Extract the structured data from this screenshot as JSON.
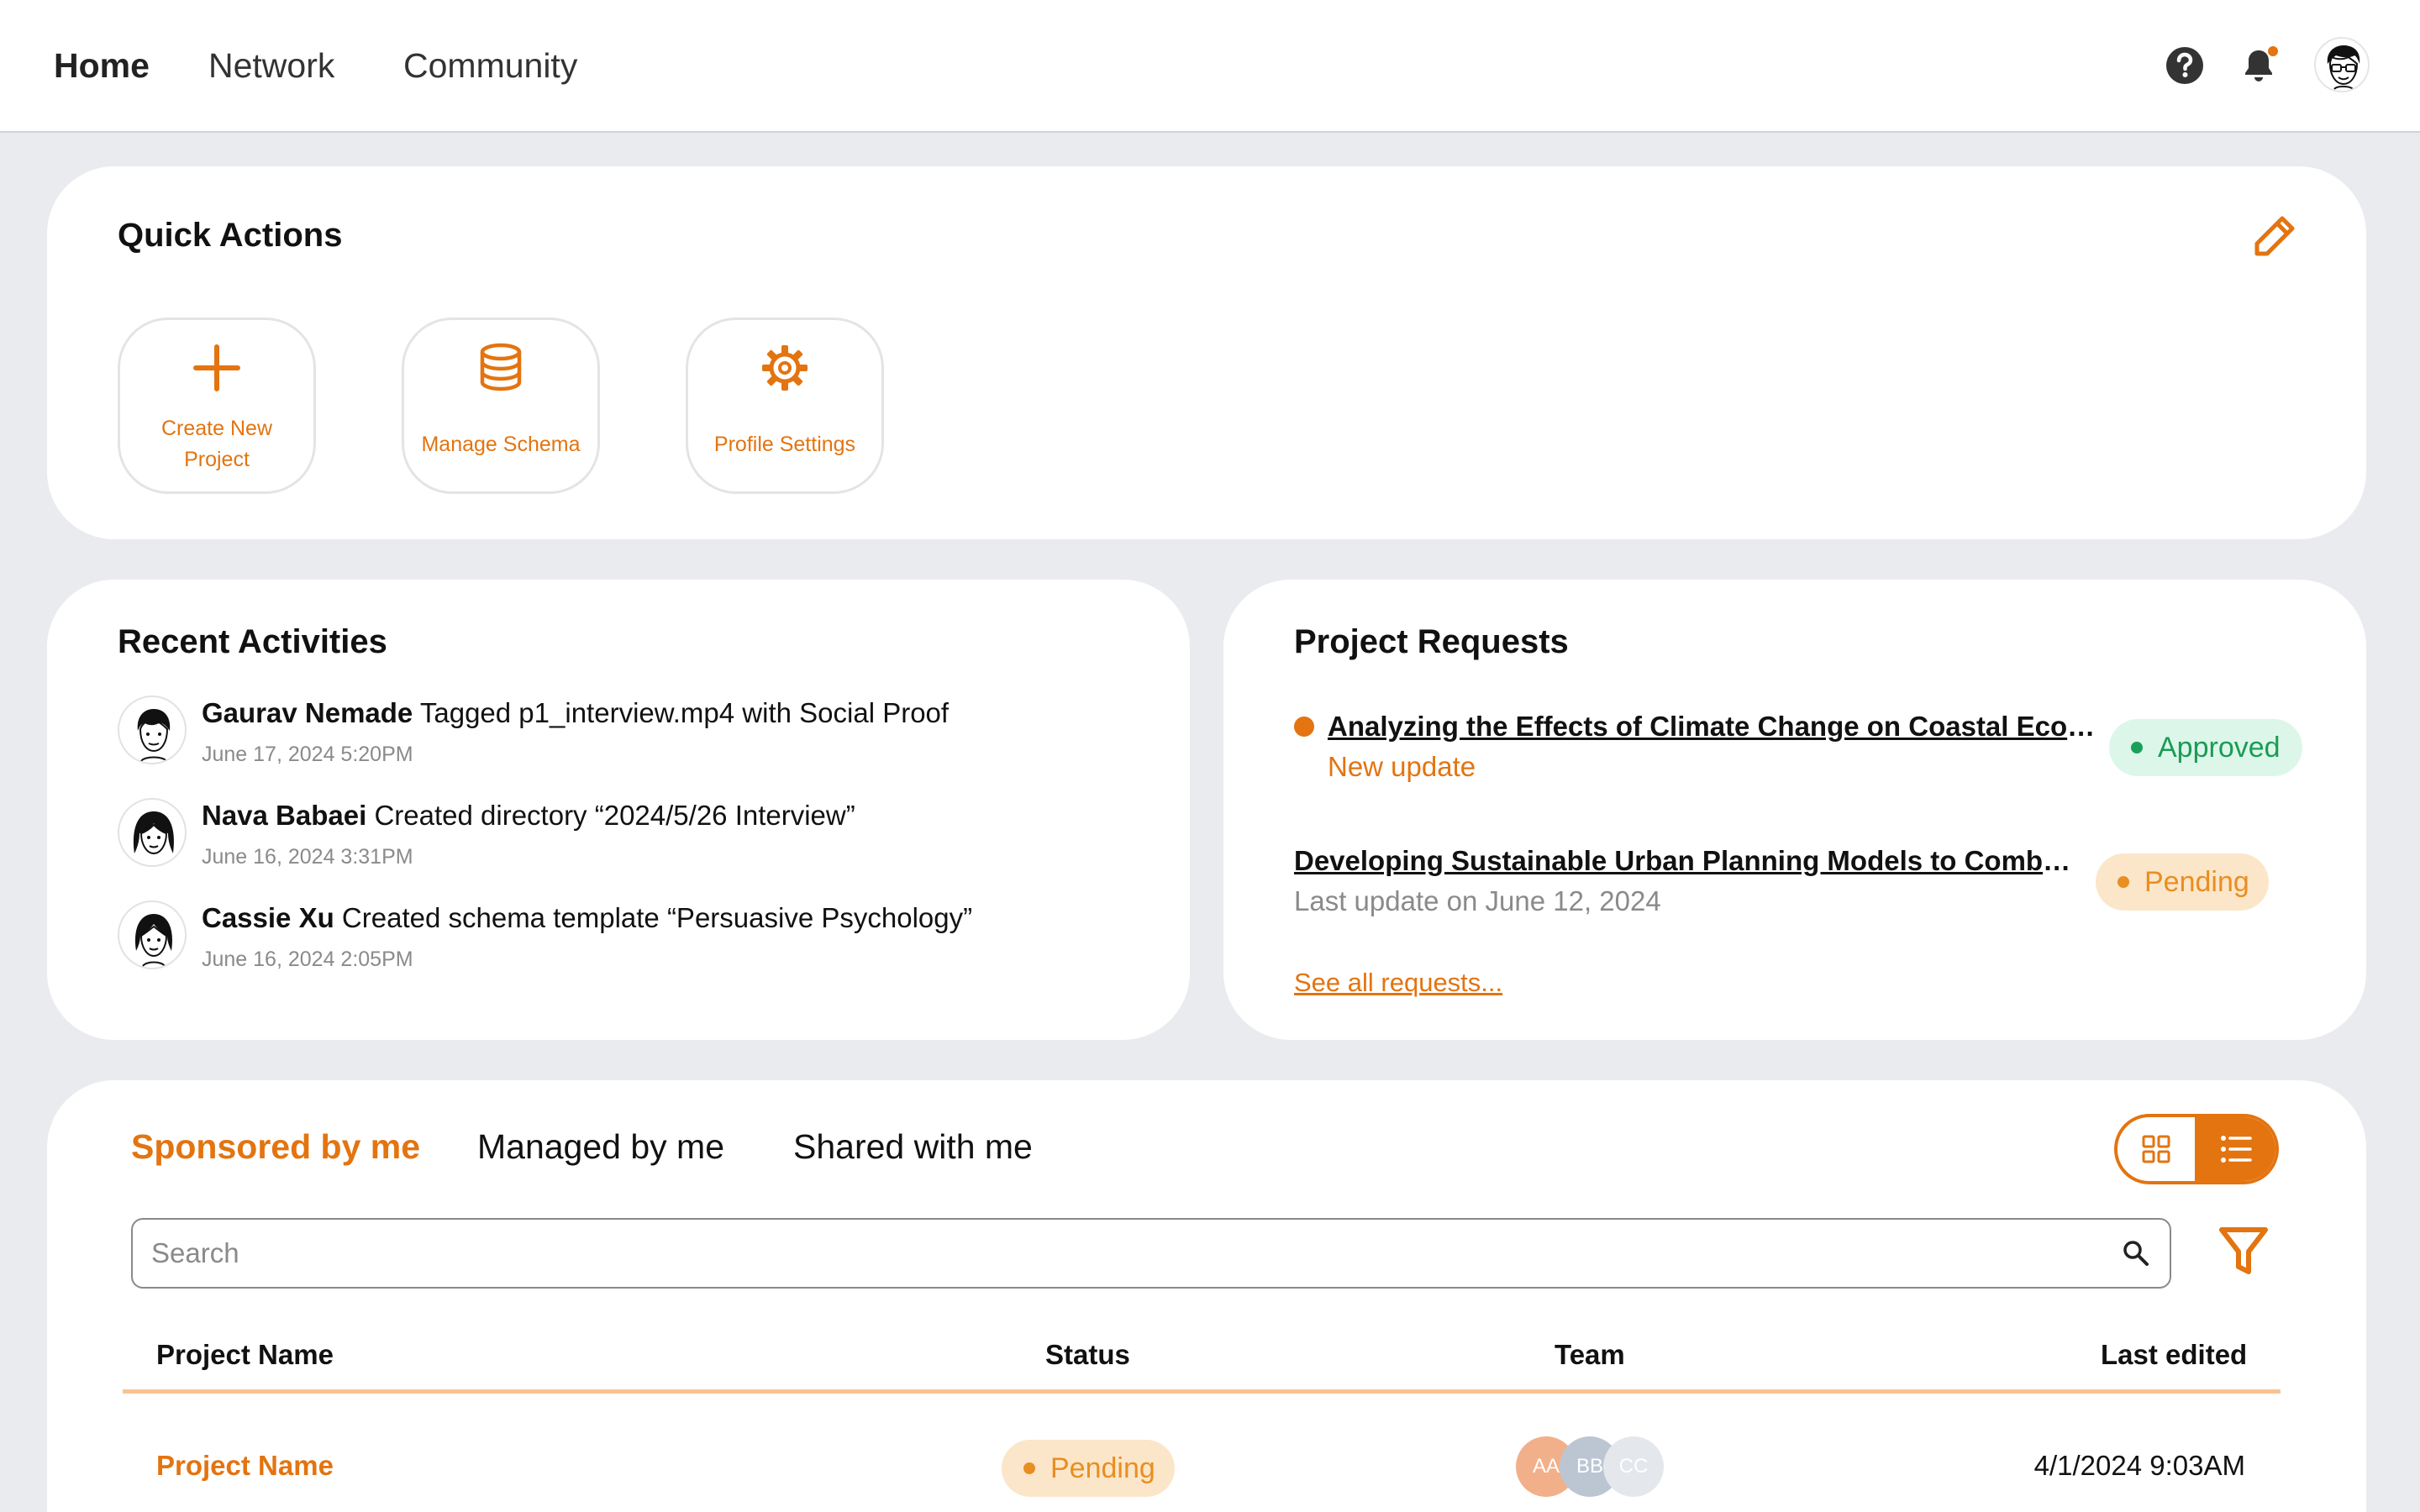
{
  "nav": {
    "tabs": [
      {
        "label": "Home",
        "active": true
      },
      {
        "label": "Network",
        "active": false
      },
      {
        "label": "Community",
        "active": false
      }
    ]
  },
  "colors": {
    "accent": "#e37410",
    "approved_bg": "#dcf7ea",
    "approved_text": "#1b9b55",
    "pending_bg": "#fce6c9",
    "pending_text": "#e98e22",
    "page_bg": "#e9ebef"
  },
  "quick_actions": {
    "title": "Quick Actions",
    "items": [
      {
        "label": "Create New Project",
        "icon": "plus-icon"
      },
      {
        "label": "Manage Schema",
        "icon": "database-icon"
      },
      {
        "label": "Profile Settings",
        "icon": "gear-icon"
      }
    ]
  },
  "recent_activities": {
    "title": "Recent Activities",
    "items": [
      {
        "name": "Gaurav Nemade",
        "action": "Tagged p1_interview.mp4 with Social Proof",
        "time": "June 17, 2024 5:20PM"
      },
      {
        "name": "Nava Babaei",
        "action": "Created directory “2024/5/26 Interview”",
        "time": "June 16, 2024 3:31PM"
      },
      {
        "name": "Cassie Xu",
        "action": "Created schema template “Persuasive Psychology”",
        "time": "June 16, 2024 2:05PM"
      }
    ]
  },
  "project_requests": {
    "title": "Project Requests",
    "items": [
      {
        "title": "Analyzing the Effects of Climate Change on Coastal Ecosy...",
        "subtitle": "New update",
        "status": "Approved"
      },
      {
        "title": "Developing Sustainable Urban Planning Models to Combat...",
        "subtitle": "Last update on June 12, 2024",
        "status": "Pending"
      }
    ],
    "see_all": "See all requests..."
  },
  "projects": {
    "tabs": [
      {
        "label": "Sponsored by me",
        "active": true
      },
      {
        "label": "Managed by me",
        "active": false
      },
      {
        "label": "Shared with me",
        "active": false
      }
    ],
    "search_placeholder": "Search",
    "columns": [
      "Project Name",
      "Status",
      "Team",
      "Last edited"
    ],
    "rows": [
      {
        "name": "Project Name",
        "status": "Pending",
        "team": [
          "AA",
          "BB",
          "CC"
        ],
        "last_edited": "4/1/2024 9:03AM"
      }
    ]
  }
}
